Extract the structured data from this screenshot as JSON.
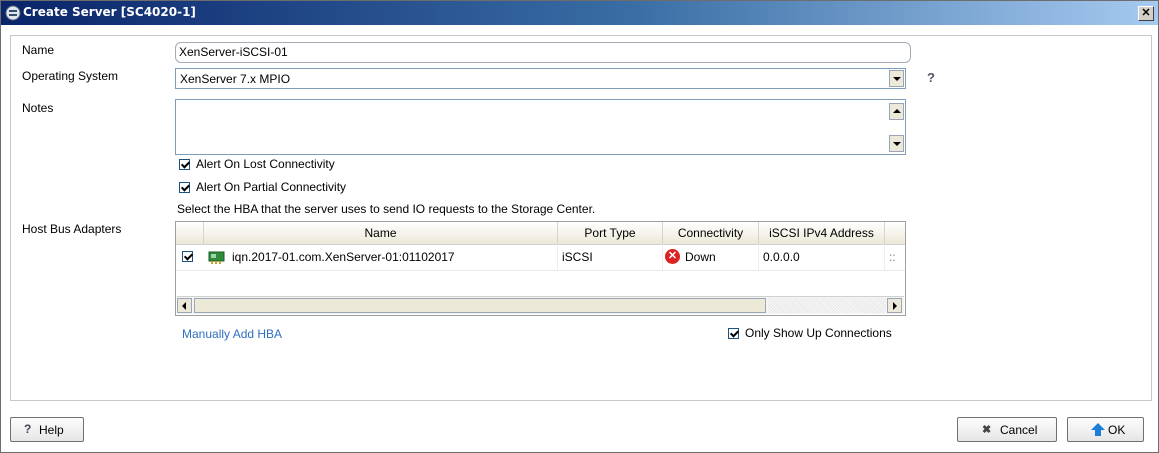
{
  "window": {
    "title": "Create Server [SC4020-1]",
    "close_label": "✕"
  },
  "form": {
    "name_label": "Name",
    "name_value": "XenServer-iSCSI-01",
    "os_label": "Operating System",
    "os_value": "XenServer 7.x MPIO",
    "help_glyph": "?",
    "notes_label": "Notes",
    "notes_value": "",
    "alert_lost_label": "Alert On Lost Connectivity",
    "alert_lost_checked": true,
    "alert_partial_label": "Alert On Partial Connectivity",
    "alert_partial_checked": true,
    "hba_instruction": "Select the HBA that the server uses to send IO requests to the Storage Center.",
    "hba_label": "Host Bus Adapters"
  },
  "hba_table": {
    "columns": [
      "Name",
      "Port Type",
      "Connectivity",
      "iSCSI IPv4 Address"
    ],
    "rows": [
      {
        "checked": true,
        "name": "iqn.2017-01.com.XenServer-01:01102017",
        "port_type": "iSCSI",
        "connectivity": "Down",
        "ipv4": "0.0.0.0",
        "extra": "::"
      }
    ]
  },
  "links": {
    "manually_add_hba": "Manually Add HBA"
  },
  "filters": {
    "only_show_up_label": "Only Show Up Connections",
    "only_show_up_checked": true
  },
  "footer": {
    "help_label": "Help",
    "cancel_label": "Cancel",
    "ok_label": "OK"
  },
  "colors": {
    "title_gradient_start": "#0a246a",
    "link": "#2f6fc0",
    "down_status": "#dd2222"
  },
  "icons": [
    "server-icon",
    "close-icon",
    "help-icon",
    "chevron-down-icon",
    "scroll-up-icon",
    "scroll-down-icon",
    "hba-port-icon",
    "error-icon",
    "scroll-left-icon",
    "scroll-right-icon",
    "cancel-icon",
    "ok-arrow-icon"
  ]
}
